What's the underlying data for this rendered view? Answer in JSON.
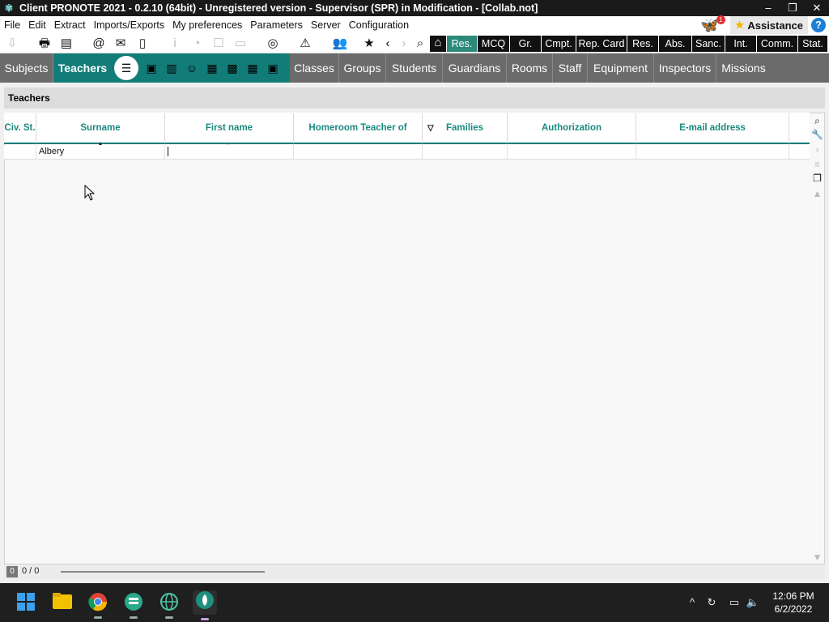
{
  "window": {
    "title": "Client PRONOTE 2021 - 0.2.10 (64bit) - Unregistered version  - Supervisor (SPR) in Modification - [Collab.not]",
    "minimize": "–",
    "maximize": "❐",
    "close": "✕"
  },
  "menu": {
    "items": [
      "File",
      "Edit",
      "Extract",
      "Imports/Exports",
      "My preferences",
      "Parameters",
      "Server",
      "Configuration"
    ],
    "notification_count": "1",
    "assistance": "Assistance",
    "help": "?"
  },
  "toolbar": {
    "tabs": [
      "Res.",
      "MCQ",
      "Gr.",
      "Cmpt.",
      "Rep. Card",
      "Res.",
      "Abs.",
      "Sanc.",
      "Int.",
      "Comm.",
      "Stat."
    ]
  },
  "main_tabs": {
    "items": [
      "Subjects",
      "Teachers",
      "Classes",
      "Groups",
      "Students",
      "Guardians",
      "Rooms",
      "Staff",
      "Equipment",
      "Inspectors",
      "Missions"
    ],
    "active": "Teachers"
  },
  "panel": {
    "title": "Teachers"
  },
  "grid": {
    "columns": [
      "Civ. St.",
      "Surname",
      "First name",
      "Homeroom Teacher of",
      "Families",
      "Authorization",
      "E-mail address"
    ],
    "rows": [
      {
        "civ": "",
        "surname": "Albery",
        "first_name": "",
        "homeroom": "",
        "families": "",
        "authorization": "",
        "email": ""
      }
    ],
    "footer_count": "0",
    "footer_pages": "0 / 0"
  },
  "taskbar": {
    "time": "12:06 PM",
    "date": "6/2/2022"
  },
  "colors": {
    "accent": "#127c78",
    "tab_bar": "#6b6b6b",
    "titlebar": "#1a1a1a"
  }
}
